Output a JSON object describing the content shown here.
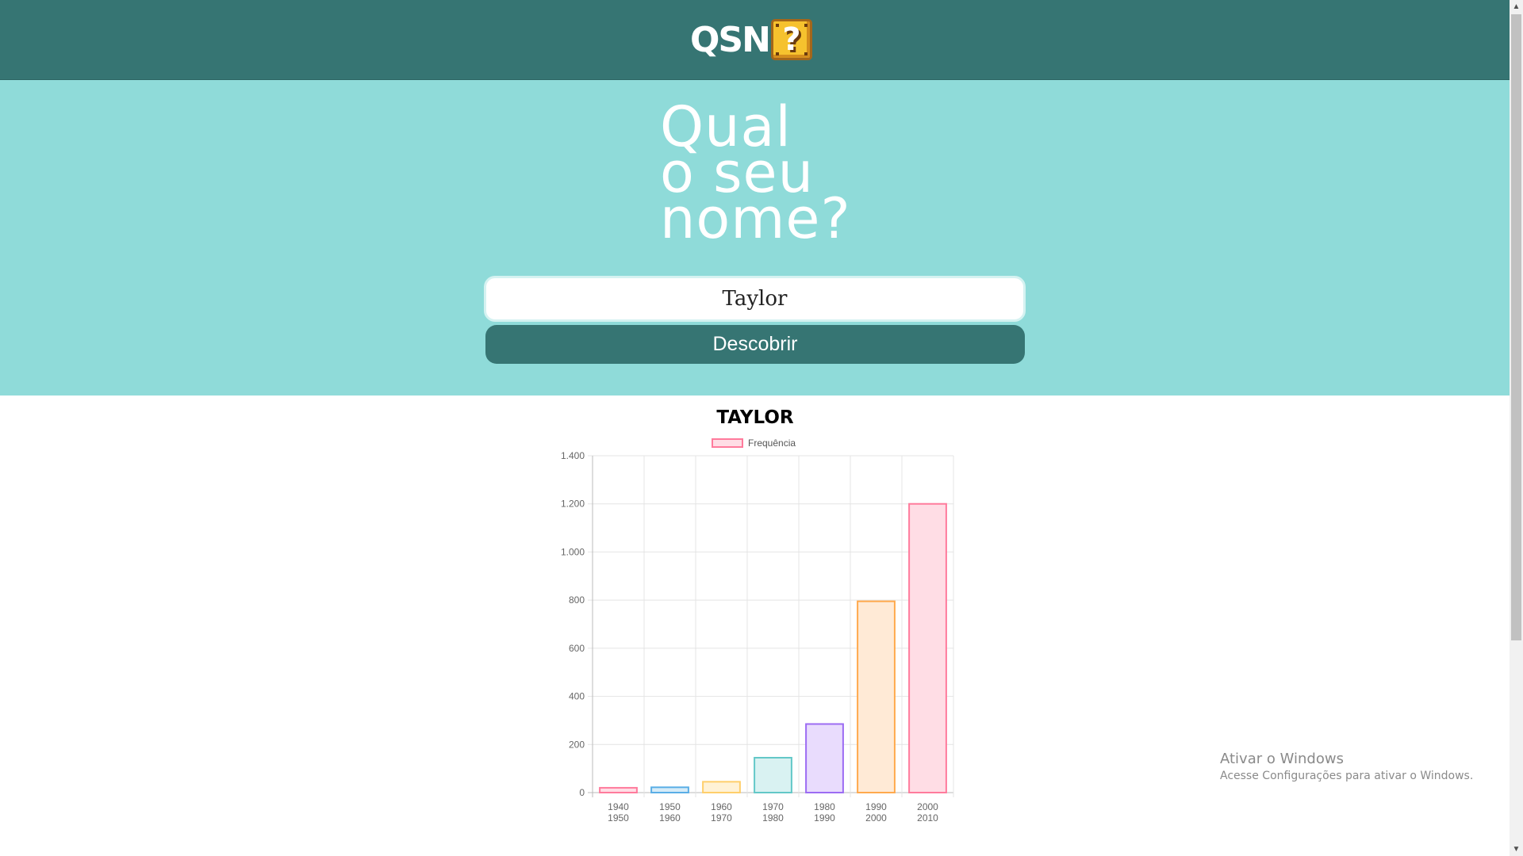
{
  "header": {
    "logo_text": "QSN",
    "logo_icon": "question-block-icon"
  },
  "hero": {
    "title_lines": [
      "Qual",
      "o seu",
      "nome?"
    ],
    "input_value": "Taylor",
    "button_label": "Descobrir"
  },
  "chart_data": {
    "type": "bar",
    "title": "TAYLOR",
    "legend": [
      "Frequência"
    ],
    "categories": [
      [
        "1940",
        "1950"
      ],
      [
        "1950",
        "1960"
      ],
      [
        "1960",
        "1970"
      ],
      [
        "1970",
        "1980"
      ],
      [
        "1980",
        "1990"
      ],
      [
        "1990",
        "2000"
      ],
      [
        "2000",
        "2010"
      ]
    ],
    "series": [
      {
        "name": "Frequência",
        "values": [
          20,
          22,
          45,
          145,
          285,
          795,
          1200
        ]
      }
    ],
    "ylim": [
      0,
      1400
    ],
    "yticks": [
      "0",
      "200",
      "400",
      "600",
      "800",
      "1.000",
      "1.200",
      "1.400"
    ],
    "grid": true,
    "colors": {
      "stroke": [
        "#ff7b9c",
        "#5aaee6",
        "#ffcf6b",
        "#63c8c8",
        "#9c6cf3",
        "#ffa94d",
        "#ff7b9c"
      ],
      "fill": [
        "#ffdde5",
        "#d6ebf8",
        "#fff2d6",
        "#d9f2f2",
        "#e9dcfd",
        "#ffead6",
        "#ffdde5"
      ]
    }
  },
  "watermark": {
    "line1": "Ativar o Windows",
    "line2": "Acesse Configurações para ativar o Windows."
  },
  "colors": {
    "header_bg": "#367573",
    "hero_bg": "#8fdbd9",
    "button_bg": "#367573"
  }
}
